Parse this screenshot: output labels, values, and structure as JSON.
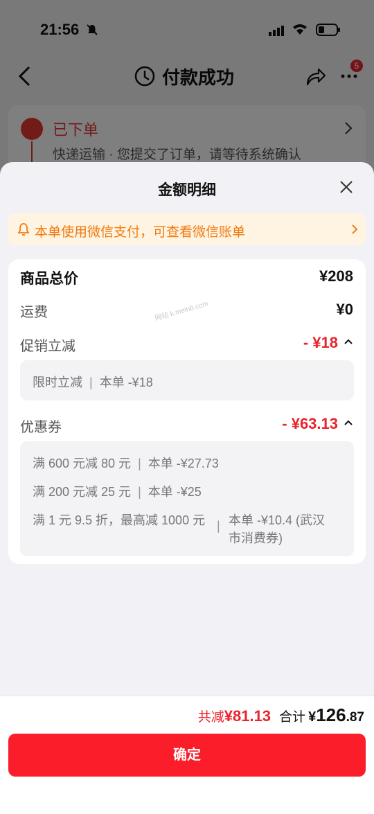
{
  "status_bar": {
    "time": "21:56"
  },
  "nav": {
    "title": "付款成功",
    "badge_count": "5"
  },
  "order": {
    "status": "已下单",
    "description": "快递运输 · 您提交了订单，请等待系统确认"
  },
  "sheet": {
    "title": "金额明细",
    "wechat_banner": "本单使用微信支付，可查看微信账单",
    "watermark": "网站 k.meinb.com",
    "rows": {
      "goods_total": {
        "label": "商品总价",
        "value": "¥208"
      },
      "shipping": {
        "label": "运费",
        "value": "¥0"
      },
      "promotion": {
        "label": "促销立减",
        "value": "- ¥18"
      },
      "coupon": {
        "label": "优惠券",
        "value": "- ¥63.13"
      }
    },
    "promotion_details": [
      {
        "name": "限时立减",
        "amount": "本单 -¥18"
      }
    ],
    "coupon_details": [
      {
        "name": "满 600 元减 80 元",
        "amount": "本单 -¥27.73"
      },
      {
        "name": "满 200 元减 25 元",
        "amount": "本单 -¥25"
      },
      {
        "name": "满 1 元 9.5 折，最高减 1000 元",
        "amount_line1": "本单 -¥10.4 (武汉",
        "amount_line2": "市消费券)"
      }
    ]
  },
  "footer": {
    "saved_label": "共减",
    "saved_amount": "¥81.13",
    "total_label": "合计",
    "total_currency": "¥",
    "total_integer": "126",
    "total_decimal": ".87",
    "confirm_label": "确定"
  },
  "colors": {
    "accent_red": "#fb1d2a",
    "discount_red": "#e8242d",
    "banner_orange": "#f07a10",
    "banner_bg": "#fff4e2"
  }
}
